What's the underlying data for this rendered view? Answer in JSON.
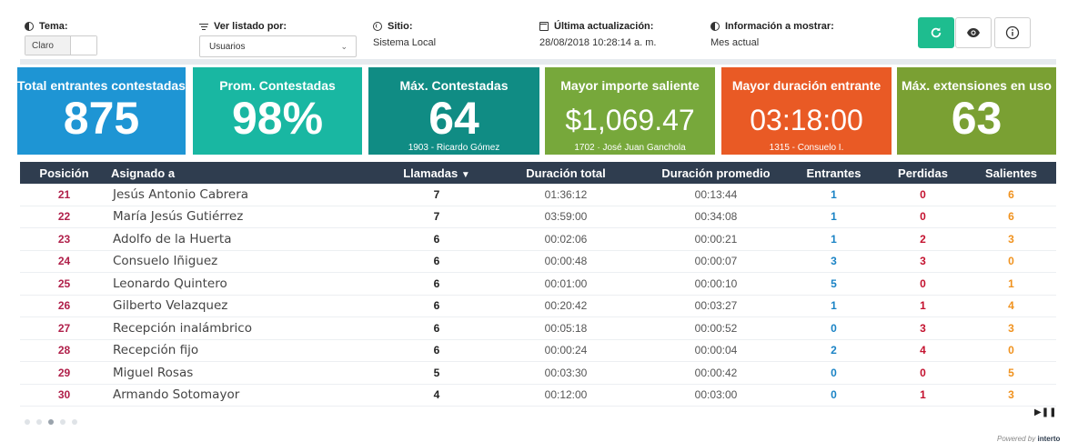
{
  "controls": {
    "tema": {
      "label": "Tema:",
      "value": "Claro"
    },
    "listado": {
      "label": "Ver listado por:",
      "value": "Usuarios"
    },
    "sitio": {
      "label": "Sitio:",
      "value": "Sistema Local"
    },
    "actualizacion": {
      "label": "Última actualización:",
      "value": "28/08/2018 10:28:14 a. m."
    },
    "informacion": {
      "label": "Información a mostrar:",
      "value": "Mes actual"
    }
  },
  "icons": {
    "refresh": "refresh-icon",
    "view": "eye-icon",
    "info": "info-icon"
  },
  "cards": [
    {
      "title": "Total entrantes contestadas",
      "value": "875",
      "sub": "",
      "color": "#1e95d4"
    },
    {
      "title": "Prom. Contestadas",
      "value": "98%",
      "sub": "",
      "color": "#19b7a2"
    },
    {
      "title": "Máx. Contestadas",
      "value": "64",
      "sub": "1903 - Ricardo Gómez",
      "color": "#108c84"
    },
    {
      "title": "Mayor importe saliente",
      "value": "$1,069.47",
      "sub": "1702 · José Juan Ganchola",
      "color": "#77a83b"
    },
    {
      "title": "Mayor duración entrante",
      "value": "03:18:00",
      "sub": "1315 - Consuelo I.",
      "color": "#e95a25"
    },
    {
      "title": "Máx. extensiones en uso",
      "value": "63",
      "sub": "",
      "color": "#7aa033"
    }
  ],
  "table": {
    "headers": {
      "posicion": "Posición",
      "asignado": "Asignado a",
      "llamadas": "Llamadas",
      "duracion_total": "Duración total",
      "duracion_promedio": "Duración promedio",
      "entrantes": "Entrantes",
      "perdidas": "Perdidas",
      "salientes": "Salientes"
    },
    "rows": [
      {
        "pos": "21",
        "name": "Jesús Antonio Cabrera",
        "llamadas": "7",
        "total": "01:36:12",
        "prom": "00:13:44",
        "ent": "1",
        "per": "0",
        "sal": "6"
      },
      {
        "pos": "22",
        "name": "María Jesús Gutiérrez",
        "llamadas": "7",
        "total": "03:59:00",
        "prom": "00:34:08",
        "ent": "1",
        "per": "0",
        "sal": "6"
      },
      {
        "pos": "23",
        "name": "Adolfo de la Huerta",
        "llamadas": "6",
        "total": "00:02:06",
        "prom": "00:00:21",
        "ent": "1",
        "per": "2",
        "sal": "3"
      },
      {
        "pos": "24",
        "name": "Consuelo Iñiguez",
        "llamadas": "6",
        "total": "00:00:48",
        "prom": "00:00:07",
        "ent": "3",
        "per": "3",
        "sal": "0"
      },
      {
        "pos": "25",
        "name": "Leonardo Quintero",
        "llamadas": "6",
        "total": "00:01:00",
        "prom": "00:00:10",
        "ent": "5",
        "per": "0",
        "sal": "1"
      },
      {
        "pos": "26",
        "name": "Gilberto Velazquez",
        "llamadas": "6",
        "total": "00:20:42",
        "prom": "00:03:27",
        "ent": "1",
        "per": "1",
        "sal": "4"
      },
      {
        "pos": "27",
        "name": "Recepción inalámbrico",
        "llamadas": "6",
        "total": "00:05:18",
        "prom": "00:00:52",
        "ent": "0",
        "per": "3",
        "sal": "3"
      },
      {
        "pos": "28",
        "name": "Recepción fijo",
        "llamadas": "6",
        "total": "00:00:24",
        "prom": "00:00:04",
        "ent": "2",
        "per": "4",
        "sal": "0"
      },
      {
        "pos": "29",
        "name": "Miguel Rosas",
        "llamadas": "5",
        "total": "00:03:30",
        "prom": "00:00:42",
        "ent": "0",
        "per": "0",
        "sal": "5"
      },
      {
        "pos": "30",
        "name": "Armando Sotomayor",
        "llamadas": "4",
        "total": "00:12:00",
        "prom": "00:03:00",
        "ent": "0",
        "per": "1",
        "sal": "3"
      }
    ]
  },
  "pager": {
    "pages": 5,
    "active": 2
  },
  "footer": {
    "powered_prefix": "Powered by",
    "brand": "interto"
  }
}
